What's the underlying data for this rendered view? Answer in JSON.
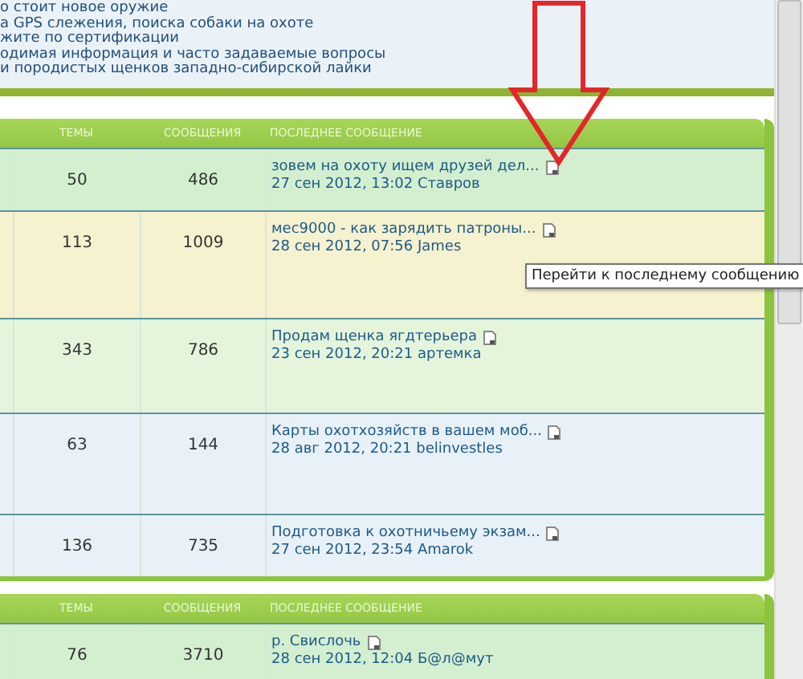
{
  "intro_lines": [
    "о стоит новое оружие",
    "а GPS слежения, поиска собаки на охоте",
    "жите по сертификации",
    "одимая информация и часто задаваемые вопросы",
    "и породистых щенков западно-сибирской лайки"
  ],
  "sections": [
    {
      "columns": [
        "ТЕМЫ",
        "СООБЩЕНИЯ",
        "ПОСЛЕДНЕЕ СООБЩЕНИЕ"
      ],
      "rows": [
        {
          "topics": "50",
          "posts": "486",
          "last_title": "зовем на охоту ищем друзей дел...",
          "last_meta": "27 сен 2012, 13:02 Ставров",
          "color": "#d3efcf"
        },
        {
          "topics": "113",
          "posts": "1009",
          "last_title": "мес9000 - как зарядить патроны...",
          "last_meta": "28 сен 2012, 07:56 James",
          "color": "#f6f1cf"
        },
        {
          "topics": "343",
          "posts": "786",
          "last_title": "Продам щенка ягдтерьера",
          "last_meta": "23 сен 2012, 20:21 артемка",
          "color": "#e4f5dc"
        },
        {
          "topics": "63",
          "posts": "144",
          "last_title": "Карты охотхозяйств в вашем моб...",
          "last_meta": "28 авг 2012, 20:21 belinvestles",
          "color": "#e8f1f7"
        },
        {
          "topics": "136",
          "posts": "735",
          "last_title": "Подготовка к охотничьему экзам...",
          "last_meta": "27 сен 2012, 23:54 Amarok",
          "color": "#e8f1f7"
        }
      ]
    },
    {
      "columns": [
        "ТЕМЫ",
        "СООБЩЕНИЯ",
        "ПОСЛЕДНЕЕ СООБЩЕНИЕ"
      ],
      "rows": [
        {
          "topics": "76",
          "posts": "3710",
          "last_title": "р. Свислочь",
          "last_meta": "28 сен 2012, 12:04 Б@л@мут",
          "color": "#d3efcf"
        }
      ]
    }
  ],
  "tooltip": "Перейти к последнему сообщению"
}
